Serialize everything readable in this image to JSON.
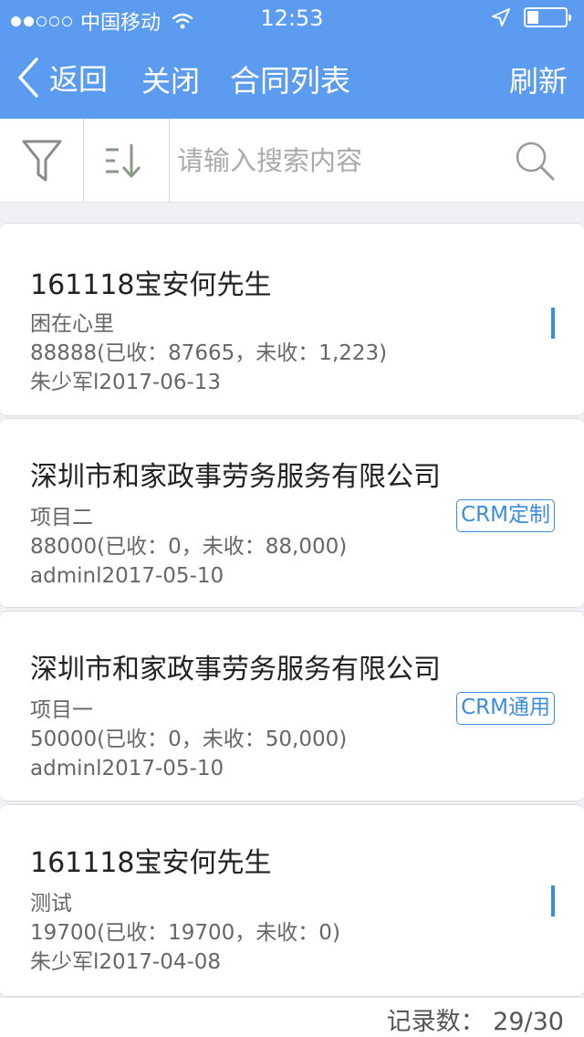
{
  "statusbar": {
    "carrier": "中国移动",
    "time": "12:53"
  },
  "nav": {
    "back": "返回",
    "close": "关闭",
    "title": "合同列表",
    "refresh": "刷新"
  },
  "search": {
    "placeholder": "请输入搜索内容"
  },
  "contracts": [
    {
      "title": "161118宝安何先生",
      "project": "困在心里",
      "amount": "88888(已收：87665，未收：1,223)",
      "meta": "朱少军l2017-06-13",
      "tag": ""
    },
    {
      "title": "深圳市和家政事劳务服务有限公司",
      "project": "项目二",
      "amount": "88000(已收：0，未收：88,000)",
      "meta": "adminl2017-05-10",
      "tag": "CRM定制"
    },
    {
      "title": "深圳市和家政事劳务服务有限公司",
      "project": "项目一",
      "amount": "50000(已收：0，未收：50,000)",
      "meta": "adminl2017-05-10",
      "tag": "CRM通用"
    },
    {
      "title": "161118宝安何先生",
      "project": "测试",
      "amount": "19700(已收：19700，未收：0)",
      "meta": "朱少军l2017-04-08",
      "tag": ""
    }
  ],
  "footer": {
    "records": "记录数：  29/30"
  },
  "colors": {
    "header": "#5b9cf0",
    "accent": "#3a8ddc"
  }
}
